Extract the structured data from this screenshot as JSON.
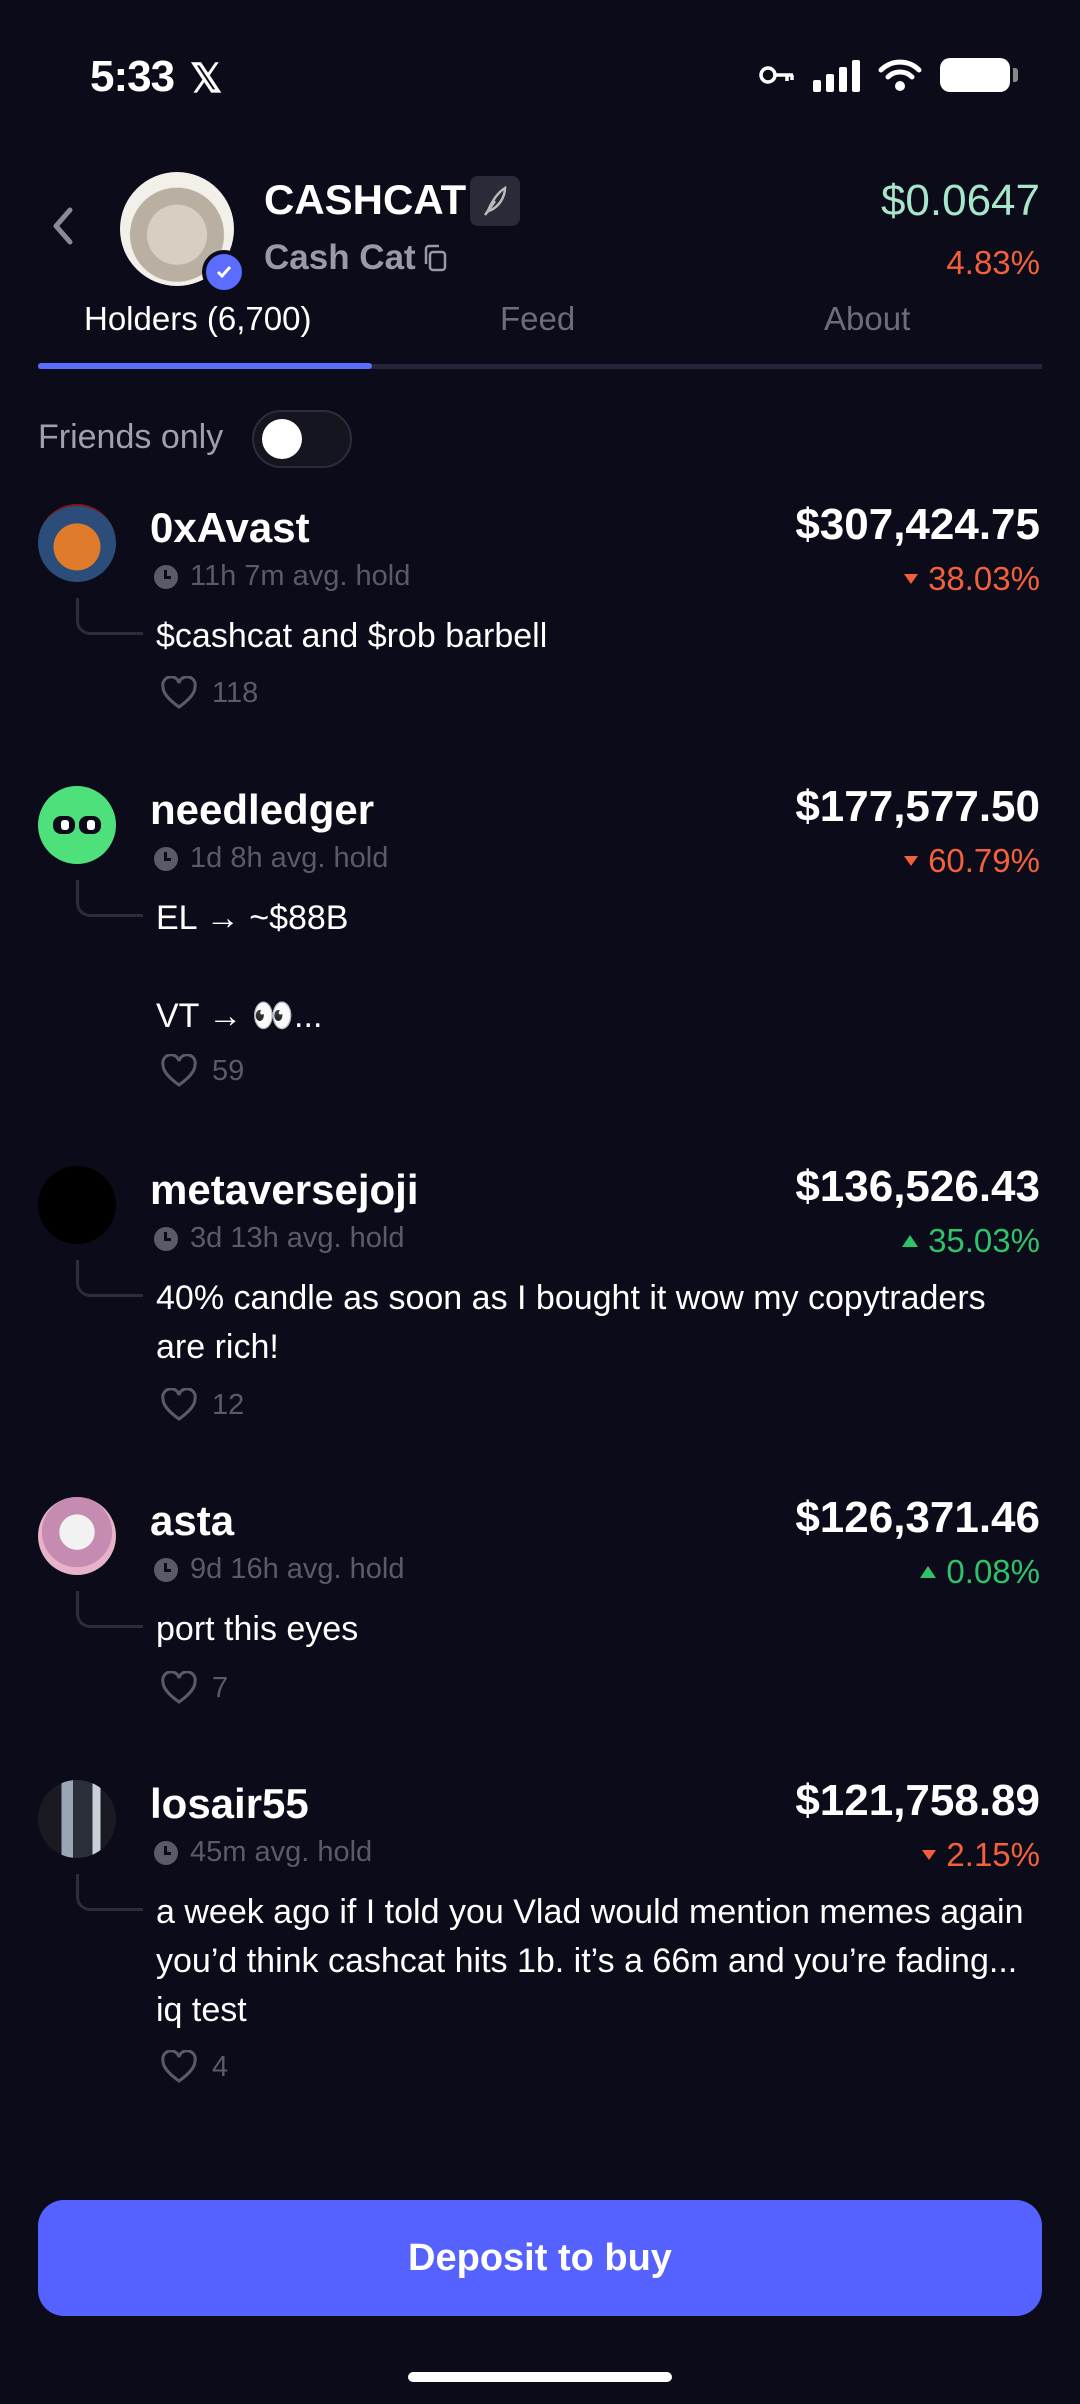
{
  "status": {
    "time": "5:33",
    "x_logo": "𝕏"
  },
  "token": {
    "symbol": "CASHCAT",
    "name": "Cash Cat",
    "price": "$0.0647",
    "change": "4.83%"
  },
  "tabs": [
    {
      "label": "Holders (6,700)"
    },
    {
      "label": "Feed"
    },
    {
      "label": "About"
    }
  ],
  "friends_only": {
    "label": "Friends only",
    "enabled": false
  },
  "holders": [
    {
      "name": "0xAvast",
      "value": "$307,424.75",
      "hold": "11h 7m avg. hold",
      "change": "38.03%",
      "direction": "down",
      "comment": "$cashcat and $rob barbell",
      "likes": "118"
    },
    {
      "name": "needledger",
      "value": "$177,577.50",
      "hold": "1d 8h avg. hold",
      "change": "60.79%",
      "direction": "down",
      "comment": "EL → ~$88B\n\nVT → 👀...",
      "likes": "59"
    },
    {
      "name": "metaversejoji",
      "value": "$136,526.43",
      "hold": "3d 13h avg. hold",
      "change": "35.03%",
      "direction": "up",
      "comment": "40% candle as soon as I bought it wow my copytraders are rich!",
      "likes": "12"
    },
    {
      "name": "asta",
      "value": "$126,371.46",
      "hold": "9d 16h avg. hold",
      "change": "0.08%",
      "direction": "up",
      "comment": "port this eyes",
      "likes": "7"
    },
    {
      "name": "losair55",
      "value": "$121,758.89",
      "hold": "45m avg. hold",
      "change": "2.15%",
      "direction": "down",
      "comment": "a week ago if I told you Vlad would mention memes again you’d think cashcat hits 1b. it’s a 66m and you’re fading... iq test",
      "likes": "4"
    }
  ],
  "cta": {
    "label": "Deposit to buy"
  },
  "colors": {
    "accent": "#5662ff",
    "down": "#f2603c",
    "up": "#2ec36a",
    "price": "#a8e6c9",
    "background": "#0b0b1a"
  }
}
